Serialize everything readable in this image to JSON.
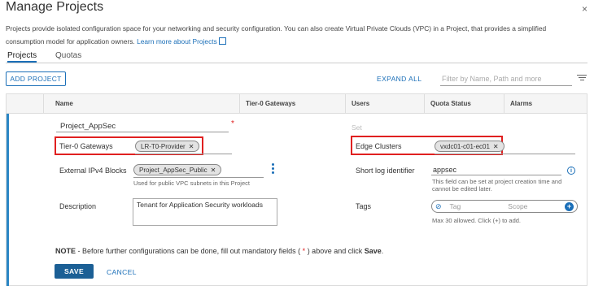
{
  "dialog": {
    "title": "Manage Projects",
    "close": "×",
    "description": "Projects provide isolated configuration space for your networking and security configuration. You can also create Virtual Private Clouds (VPC) in a Project, that provides a simplified consumption model for application owners.",
    "learn_more": "Learn more about Projects"
  },
  "tabs": [
    {
      "label": "Projects",
      "active": true
    },
    {
      "label": "Quotas",
      "active": false
    }
  ],
  "toolbar": {
    "add_project": "ADD PROJECT",
    "expand_all": "EXPAND ALL",
    "filter_placeholder": "Filter by Name, Path and more"
  },
  "table": {
    "headers": [
      "Name",
      "Tier-0 Gateways",
      "Users",
      "Quota Status",
      "Alarms"
    ]
  },
  "form": {
    "name_value": "Project_AppSec",
    "required_mark": "*",
    "users_value": "Set",
    "tier0_label": "Tier-0 Gateways",
    "tier0_chip": "LR-T0-Provider",
    "edge_label": "Edge Clusters",
    "edge_chip": "vxdc01-c01-ec01",
    "ipv4_label": "External IPv4 Blocks",
    "ipv4_chip": "Project_AppSec_Public",
    "ipv4_help": "Used for public VPC subnets in this Project",
    "shortlog_label": "Short log identifier",
    "shortlog_value": "appsec",
    "shortlog_help": "This field can be set at project creation time and cannot be edited later.",
    "desc_label": "Description",
    "desc_value": "Tenant for Application Security workloads",
    "tags_label": "Tags",
    "tag_placeholder": "Tag",
    "scope_placeholder": "Scope",
    "tags_help": "Max 30 allowed. Click (+) to add.",
    "note_bold": "NOTE",
    "note_text": " - Before further configurations can be done, fill out mandatory fields ( ",
    "note_star": "*",
    "note_text2": " ) above and click ",
    "note_save": "Save",
    "note_end": ".",
    "save": "SAVE",
    "cancel": "CANCEL"
  },
  "colors": {
    "accent": "#1b6fb8",
    "highlight": "#e02020",
    "save_bg": "#1b5f95"
  }
}
